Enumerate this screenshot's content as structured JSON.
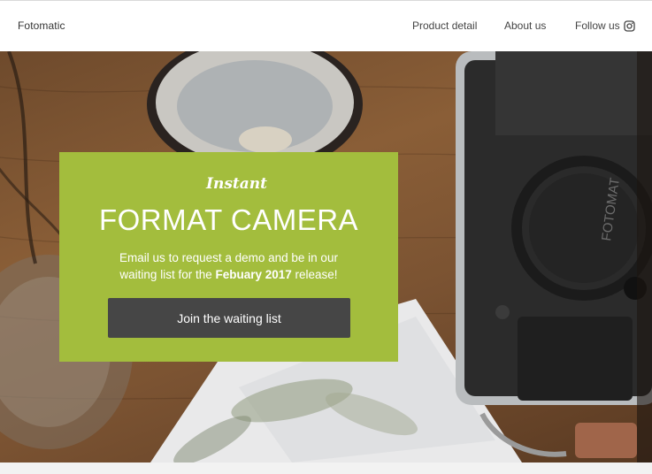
{
  "header": {
    "brand": "Fotomatic",
    "nav": {
      "product_detail": "Product detail",
      "about_us": "About us",
      "follow_us": "Follow us"
    },
    "social_icon": "instagram-icon"
  },
  "hero": {
    "camera_label": "FOTOMAT",
    "card": {
      "kicker": "Instant",
      "title": "FORMAT CAMERA",
      "text_before": "Email us to request a demo and be in our waiting list for the ",
      "text_bold": "Febuary 2017",
      "text_after": " release!",
      "button_label": "Join the waiting list"
    }
  },
  "colors": {
    "card_background": "#a3bd3d",
    "button_background": "#464646",
    "header_background": "#ffffff"
  }
}
